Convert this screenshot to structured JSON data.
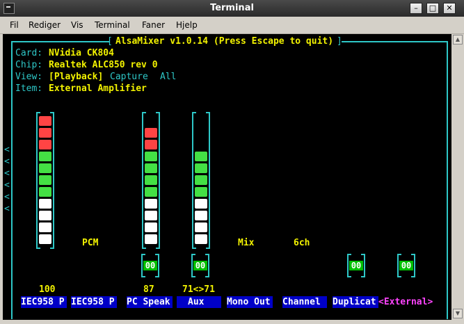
{
  "window": {
    "title": "Terminal"
  },
  "menu": [
    {
      "label": "Fil"
    },
    {
      "label": "Rediger"
    },
    {
      "label": "Vis"
    },
    {
      "label": "Terminal"
    },
    {
      "label": "Faner"
    },
    {
      "label": "Hjelp"
    }
  ],
  "window_buttons": {
    "minimize": "–",
    "maximize": "□",
    "close": "✕"
  },
  "alsamixer": {
    "header": "AlsaMixer v1.0.14 (Press Escape to quit)",
    "info": [
      {
        "key": "Card:",
        "value": "NVidia CK804"
      },
      {
        "key": "Chip:",
        "value": "Realtek ALC850 rev 0"
      },
      {
        "key": "View:",
        "value": "[Playback]",
        "extra1": "Capture",
        "extra2": "All"
      },
      {
        "key": "Item:",
        "value": "External Amplifier"
      }
    ],
    "channels": [
      {
        "label": "IEC958 P",
        "volume": "100",
        "switch": "",
        "selected": false
      },
      {
        "label": "IEC958 P",
        "volume": "",
        "switch": "",
        "selected": false
      },
      {
        "label": "PC Speak",
        "volume": "87",
        "switch": "00",
        "selected": false
      },
      {
        "label": "Aux",
        "volume": "71<>71",
        "switch": "00",
        "selected": false
      },
      {
        "label": "Mono Out",
        "volume": "",
        "switch": "",
        "selected": false
      },
      {
        "label": "Channel",
        "volume": "",
        "switch": "",
        "selected": false
      },
      {
        "label": "Duplicat",
        "volume": "",
        "switch": "00",
        "selected": false
      },
      {
        "label": "<External>",
        "volume": "",
        "switch": "00",
        "selected": true
      }
    ],
    "mid_labels": [
      {
        "text": "PCM"
      },
      {
        "text": "Mix"
      },
      {
        "text": "6ch"
      }
    ],
    "level_fraction": [
      1.0,
      0,
      0.87,
      0.71
    ],
    "colors": {
      "red": "#ff4444",
      "green": "#44e044",
      "white": "#ffffff",
      "cyan": "#2ec8c8",
      "yellow": "#f2f200",
      "blue": "#0000c8",
      "selected": "#ff44ff"
    }
  }
}
